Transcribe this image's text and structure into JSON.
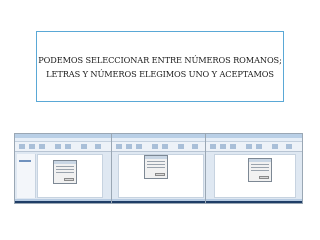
{
  "slide": {
    "caption": "PODEMOS SELECCIONAR ENTRE NÚMEROS ROMANOS;\nLETRAS Y NÚMEROS ELEGIMOS UNO Y ACEPTAMOS"
  },
  "screenshots": [
    {
      "name": "word-screenshot-1"
    },
    {
      "name": "word-screenshot-2"
    },
    {
      "name": "word-screenshot-3"
    }
  ],
  "colors": {
    "border_accent": "#5aa8d6",
    "ribbon": "#edf2f8",
    "taskbar": "#1f3d66"
  }
}
